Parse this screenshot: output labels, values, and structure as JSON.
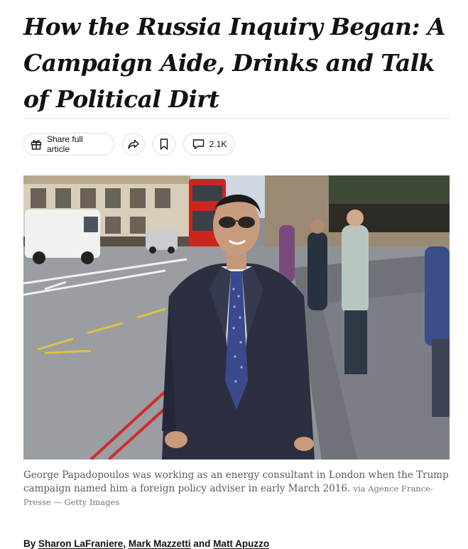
{
  "article": {
    "headline": "How the Russia Inquiry Began: A Campaign Aide, Drinks and Talk of Political Dirt"
  },
  "toolbar": {
    "share_label": "Share full article",
    "comment_count": "2.1K",
    "icons": [
      "gift-icon",
      "share-arrow-icon",
      "bookmark-icon",
      "comment-icon"
    ]
  },
  "image": {
    "caption": "George Papadopoulos was working as an energy consultant in London when the Trump campaign named him a foreign policy adviser in early March 2016.",
    "credit": "via Agence France-Presse — Getty Images"
  },
  "byline": {
    "prefix": "By",
    "authors": [
      "Sharon LaFraniere",
      "Mark Mazzetti",
      "Matt Apuzzo"
    ],
    "separator": ",",
    "conjunction": "and"
  }
}
